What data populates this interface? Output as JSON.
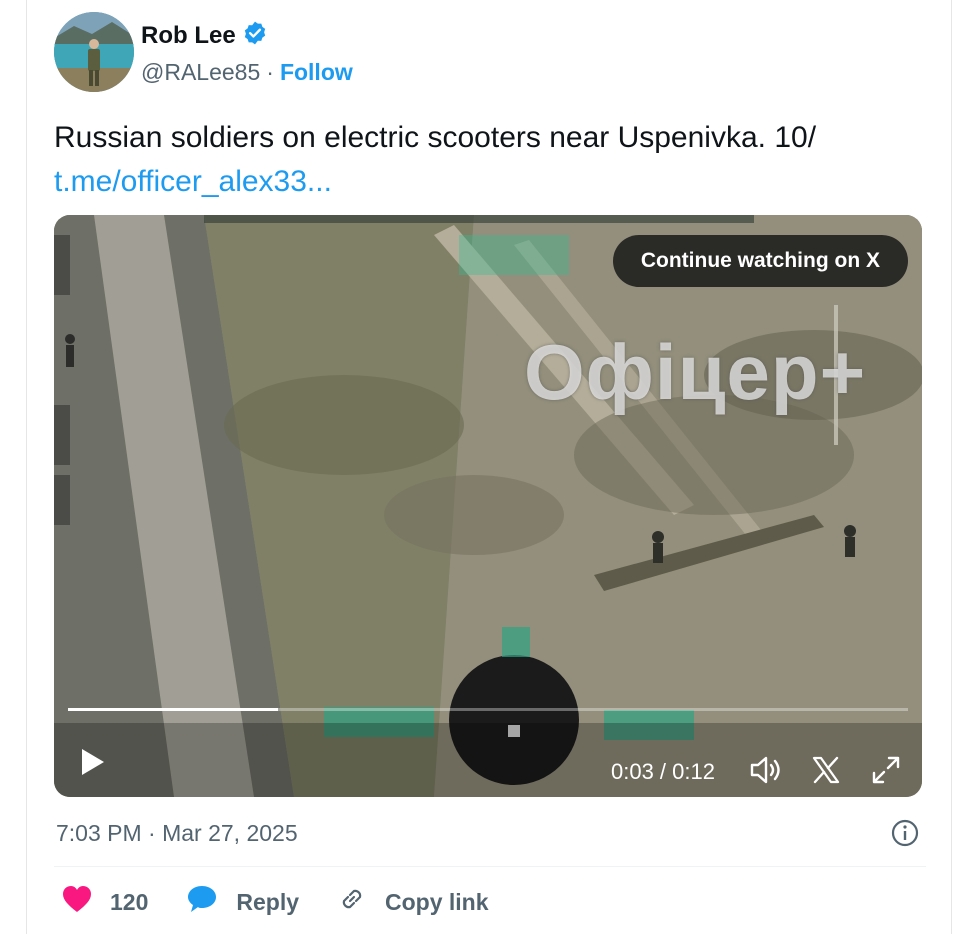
{
  "author": {
    "name": "Rob Lee",
    "handle": "@RALee85",
    "separator": "·",
    "follow_label": "Follow"
  },
  "tweet": {
    "text": "Russian soldiers on electric scooters near Uspenivka. 10/",
    "link": "t.me/officer_alex33..."
  },
  "video": {
    "continue_label": "Continue watching on X",
    "watermark": "Офіцер+",
    "time": "0:03 / 0:12",
    "progress": 0.25
  },
  "meta": {
    "timestamp": "7:03 PM · Mar 27, 2025"
  },
  "actions": {
    "likes": "120",
    "reply_label": "Reply",
    "copy_label": "Copy link"
  },
  "colors": {
    "accent": "#1d9bf0",
    "like": "#f91880",
    "text": "#0f1419",
    "secondary": "#536471"
  },
  "icons": [
    "verified-badge-icon",
    "play-icon",
    "volume-icon",
    "x-logo-icon",
    "fullscreen-icon",
    "info-icon",
    "heart-icon",
    "reply-icon",
    "link-icon"
  ]
}
